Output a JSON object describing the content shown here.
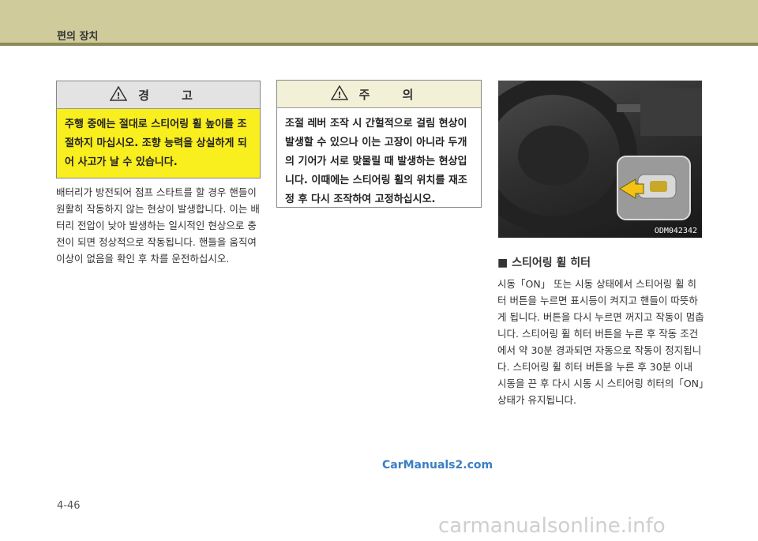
{
  "header": {
    "title": "편의 장치"
  },
  "warning": {
    "title": "경 고",
    "body": "주행 중에는 절대로 스티어링 휠 높이를 조절하지 마십시오. 조향 능력을 상실하게 되어 사고가 날 수 있습니다."
  },
  "caution": {
    "title": "주 의",
    "body": "조절 레버 조작 시 간헐적으로 걸림 현상이 발생할 수 있으나 이는 고장이 아니라 두개의 기어가 서로 맞물릴 때 발생하는 현상입니다. 이때에는 스티어링 휠의 위치를 재조정 후 다시 조작하여 고정하십시오."
  },
  "left_paragraph": "배터리가 방전되어 점프 스타트를 할 경우 핸들이 원활히 작동하지 않는 현상이 발생합니다. 이는 배터리 전압이 낮아 발생하는 일시적인 현상으로 충전이 되면 정상적으로 작동됩니다. 핸들을 움직여 이상이 없음을 확인 후 차를 운전하십시오.",
  "photo": {
    "label": "ODM042342"
  },
  "section": {
    "title": "■ 스티어링 휠 히터",
    "body": "시동「ON」 또는 시동 상태에서 스티어링 휠 히터 버튼을 누르면 표시등이 켜지고 핸들이 따뜻하게 됩니다. 버튼을 다시 누르면 꺼지고 작동이 멈춥니다. 스티어링 휠 히터 버튼을 누른 후 작동 조건에서 약 30분 경과되면 자동으로 작동이 정지됩니다. 스티어링 휠 히터 버튼을 누른 후 30분 이내 시동을 끈 후 다시 시동 시 스티어링 히터의「ON」상태가 유지됩니다."
  },
  "watermark": "CarManuals2.com",
  "page_number": "4-46",
  "footer": "carmanualsonline.info"
}
